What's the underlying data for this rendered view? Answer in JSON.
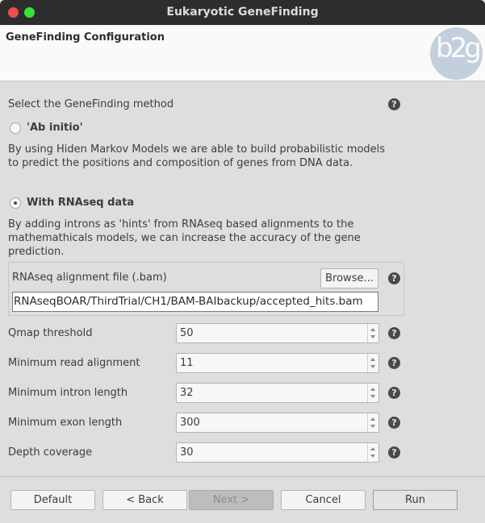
{
  "window": {
    "title": "Eukaryotic GeneFinding"
  },
  "header": {
    "title": "GeneFinding Configuration",
    "logo_text": "b2g"
  },
  "method": {
    "prompt": "Select the GeneFinding method",
    "help_icon": "?",
    "options": [
      {
        "label": "'Ab initio'",
        "selected": false,
        "description": [
          "By using Hiden Markov Models we are able to build probabilistic models",
          "to predict the positions and composition of genes from DNA data."
        ]
      },
      {
        "label": "With RNAseq data",
        "selected": true,
        "description": [
          "By adding introns as 'hints' from RNAseq based alignments to the",
          "mathemathicals models, we can increase the accuracy of the gene",
          "prediction."
        ]
      }
    ]
  },
  "file": {
    "label": "RNAseq alignment file (.bam)",
    "browse_label": "Browse...",
    "value": "RNAseqBOAR/ThirdTrial/CH1/BAM-BAIbackup/accepted_hits.bam"
  },
  "params": [
    {
      "label": "Qmap threshold",
      "value": "50"
    },
    {
      "label": "Minimum read alignment",
      "value": "11"
    },
    {
      "label": "Minimum intron length",
      "value": "32"
    },
    {
      "label": "Minimum exon length",
      "value": "300"
    },
    {
      "label": "Depth coverage",
      "value": "30"
    }
  ],
  "buttons": {
    "default": "Default",
    "back": "< Back",
    "next": "Next >",
    "cancel": "Cancel",
    "run": "Run"
  }
}
